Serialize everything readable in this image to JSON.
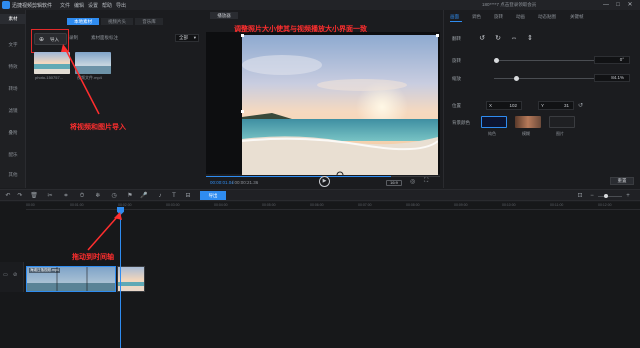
{
  "app": {
    "title": "迅捷视频剪辑软件",
    "menu": [
      "文件",
      "编辑",
      "设置",
      "帮助",
      "导出"
    ],
    "login_text": "180****7  点击登录领取会员",
    "window_controls": [
      "—",
      "□",
      "✕"
    ]
  },
  "left_nav": {
    "items": [
      "素材",
      "文字",
      "特效",
      "转场",
      "滤镜",
      "叠附",
      "配乐",
      "其他"
    ],
    "active_index": 0
  },
  "media": {
    "tabs": [
      "本地素材",
      "视频片头",
      "音乐库"
    ],
    "active_tab": 0,
    "import_label": "导入",
    "actions": [
      "录制",
      "素材面板标注"
    ],
    "filter_value": "全部",
    "thumbnails": [
      {
        "label": "photo-150757..."
      },
      {
        "label": "视频文件.mp4"
      }
    ],
    "annotation": "将视频和图片导入"
  },
  "preview": {
    "title": "播放器",
    "annotation": "调整照片大小使其与视频播放大小界面一致",
    "time_current": "00:00:01.04",
    "time_total": "/ 00:00:21.36",
    "ratio_label": "16:9",
    "progress": 0.79
  },
  "properties": {
    "tabs": [
      "画面",
      "调色",
      "旋转",
      "动画",
      "动态贴图",
      "关键帧"
    ],
    "active_tab": 0,
    "flip_label": "翻转",
    "rotate_label": "旋转",
    "rotate_value": "0°",
    "rotate_level": 0.0,
    "scale_label": "缩放",
    "scale_value": "84.1%",
    "scale_level": 0.2,
    "position_label": "位置",
    "pos_x_label": "X",
    "pos_x": "102",
    "pos_y_label": "Y",
    "pos_y": "31",
    "bg_label": "背景颜色",
    "bg_options": [
      "纯色",
      "模糊",
      "图片"
    ],
    "reset_label": "重置"
  },
  "toolbar": {
    "export_label": "导出",
    "icons": [
      "undo-icon",
      "redo-icon",
      "delete-icon",
      "split-icon",
      "crop-icon",
      "speed-icon",
      "freeze-icon",
      "mic-icon",
      "mark-icon",
      "duration-icon"
    ]
  },
  "timeline": {
    "ticks": [
      "00:00",
      "00:01:00",
      "00:02:00",
      "00:03:00",
      "00:04:00",
      "00:05:00",
      "00:06:00",
      "00:07:00",
      "00:08:00",
      "00:09:00",
      "00:10:00",
      "00:11:00",
      "00:12:00"
    ],
    "clip_label": "海滩日落视频.mp4",
    "annotation": "拖动到时间轴"
  },
  "colors": {
    "accent": "#2f8cf0",
    "annotation_red": "#ff2e2e",
    "background": "#1b1c1f"
  }
}
